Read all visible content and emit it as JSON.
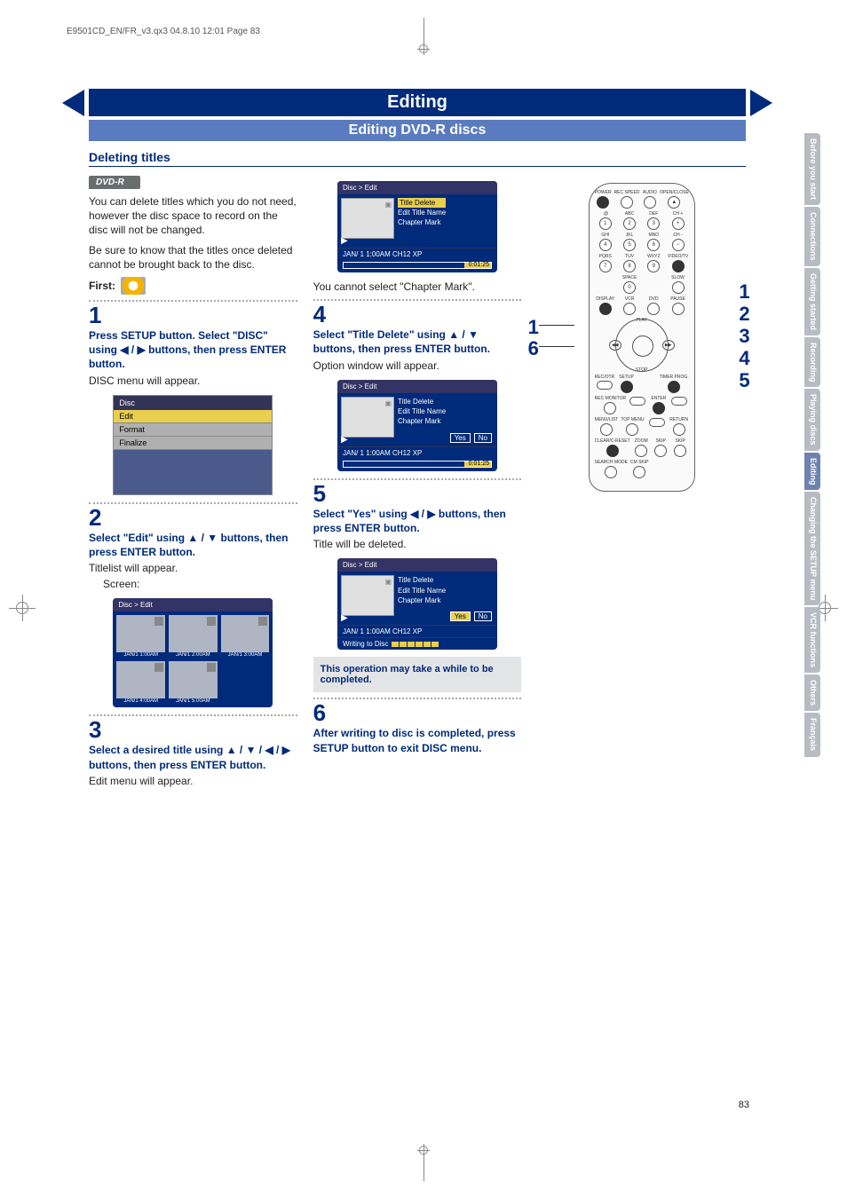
{
  "header_line": "E9501CD_EN/FR_v3.qx3  04.8.10  12:01  Page 83",
  "titles": {
    "main": "Editing",
    "sub": "Editing DVD-R discs",
    "subtitle": "Deleting titles"
  },
  "badge": "DVD-R",
  "intro_p1": "You can delete titles which you do not need, however the disc space to record on the disc will not be changed.",
  "intro_p2": "Be sure to know that the titles once deleted cannot be brought back to the disc.",
  "first": "First:",
  "steps": {
    "s1": {
      "num": "1",
      "instr": "Press SETUP button. Select \"DISC\" using ◀ / ▶ buttons, then press ENTER button.",
      "body": "DISC menu will appear."
    },
    "s2": {
      "num": "2",
      "instr": "Select \"Edit\" using ▲ / ▼ buttons, then press ENTER button.",
      "body": "Titlelist will appear.",
      "body2": "Screen:"
    },
    "s3": {
      "num": "3",
      "instr": "Select a desired title using ▲ / ▼ / ◀ / ▶ buttons, then press ENTER button.",
      "body": "Edit menu will appear."
    },
    "s4": {
      "num": "4",
      "instr": "Select \"Title Delete\" using ▲ / ▼ buttons, then press ENTER button.",
      "body": "Option window will appear."
    },
    "s5": {
      "num": "5",
      "instr": "Select \"Yes\" using ◀ / ▶ buttons, then press ENTER button.",
      "body": "Title will be deleted."
    },
    "s6": {
      "num": "6",
      "instr": "After writing to disc is completed, press SETUP button to exit DISC menu."
    }
  },
  "s3_note": "You cannot select \"Chapter Mark\".",
  "notebox": "This operation may take a while to be completed.",
  "discmenu": {
    "title": "Disc",
    "items": [
      "Edit",
      "Format",
      "Finalize"
    ]
  },
  "editlist": [
    "Title Delete",
    "Edit Title Name",
    "Chapter Mark"
  ],
  "yes": "Yes",
  "no": "No",
  "screen_breadcrumb": "Disc > Edit",
  "screen_footer": "JAN/ 1   1:00AM  CH12     XP",
  "screen_time": "0:01:25",
  "writing": "Writing to Disc",
  "titlelist_cells": [
    "JAN/1  1:00AM",
    "JAN/1  2:00AM",
    "JAN/1  3:00AM",
    "JAN/1  4:00AM",
    "JAN/1  5:00AM"
  ],
  "tabs": [
    "Before you start",
    "Connections",
    "Getting started",
    "Recording",
    "Playing discs",
    "Editing",
    "Changing the SETUP menu",
    "VCR functions",
    "Others",
    "Français"
  ],
  "active_tab_index": 5,
  "page_number": "83",
  "remote": {
    "row1": [
      "POWER",
      "REC SPEED",
      "AUDIO",
      "OPEN/CLOSE"
    ],
    "row_nums": [
      [
        ".@",
        "ABC",
        "DEF",
        ""
      ],
      [
        "1",
        "2",
        "3",
        "CH +"
      ],
      [
        "GHI",
        "JKL",
        "MNO",
        ""
      ],
      [
        "4",
        "5",
        "6",
        "CH -"
      ],
      [
        "PQRS",
        "TUV",
        "WXYZ",
        "VIDEO/TV"
      ],
      [
        "7",
        "8",
        "9",
        ""
      ],
      [
        "",
        "SPACE",
        "",
        "SLOW"
      ],
      [
        "",
        "0",
        "",
        ""
      ]
    ],
    "row_mode": [
      "DISPLAY",
      "VCR",
      "DVD",
      "PAUSE"
    ],
    "ring": {
      "up": "PLAY",
      "down": "STOP",
      "left": "◀◀",
      "right": "▶▶"
    },
    "row_setup": [
      "REC/OTR",
      "SETUP",
      "",
      "TIMER PROG."
    ],
    "row_mon": [
      "REC MONITOR",
      "",
      "ENTER",
      ""
    ],
    "row_menu": [
      "MENU/LIST",
      "TOP MENU",
      "",
      "RETURN"
    ],
    "row_skip": [
      "CLEAR/C-RESET",
      "ZOOM",
      "SKIP",
      "SKIP"
    ],
    "row_last": [
      "SEARCH MODE",
      "CM SKIP",
      "",
      ""
    ]
  },
  "callouts": {
    "left": [
      "1",
      "6"
    ],
    "right": [
      "1",
      "2",
      "3",
      "4",
      "5"
    ]
  }
}
